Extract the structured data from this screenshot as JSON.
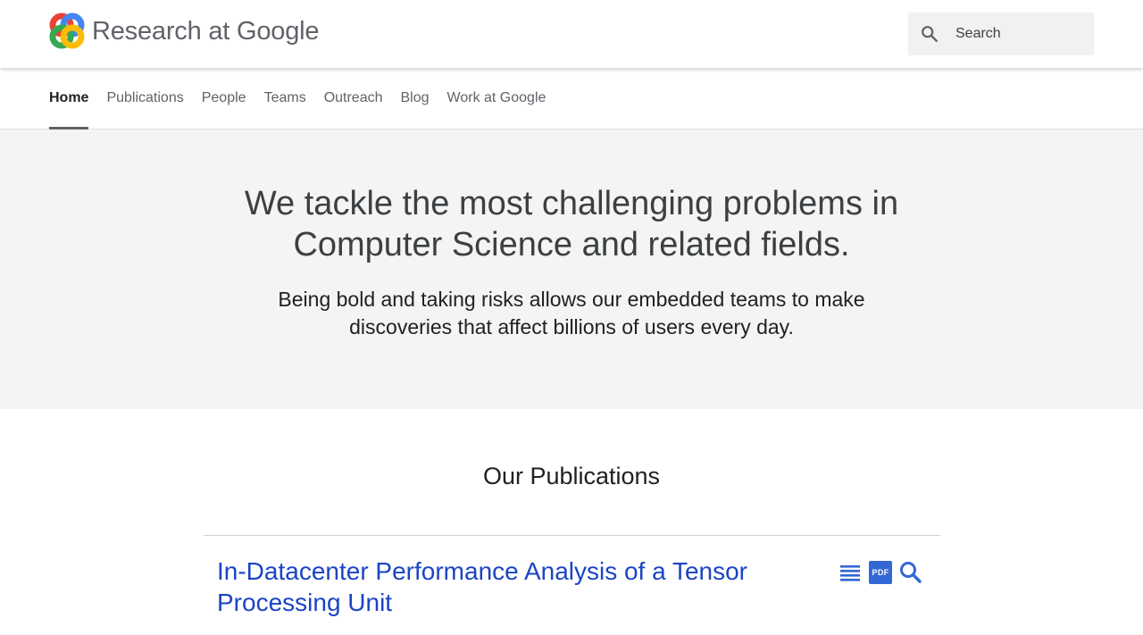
{
  "header": {
    "brand": "Research at Google",
    "search": {
      "placeholder": "Search"
    },
    "logo_colors": [
      "#ea4335",
      "#4285f4",
      "#34a853",
      "#fbbc05"
    ]
  },
  "nav": {
    "items": [
      {
        "label": "Home",
        "active": true
      },
      {
        "label": "Publications"
      },
      {
        "label": "People"
      },
      {
        "label": "Teams"
      },
      {
        "label": "Outreach"
      },
      {
        "label": "Blog"
      },
      {
        "label": "Work at Google"
      }
    ]
  },
  "hero": {
    "headline": "We tackle the most challenging problems in Computer Science and related fields.",
    "subtext": "Being bold and taking risks allows our embedded teams to make discoveries that affect billions of users every day."
  },
  "publications": {
    "heading": "Our Publications",
    "items": [
      {
        "title": "In-Datacenter Performance Analysis of a Tensor Processing Unit",
        "actions": {
          "abstract_icon": "list-icon",
          "pdf_label": "PDF",
          "search_icon": "search-icon"
        }
      }
    ]
  },
  "colors": {
    "link": "#1a44c4",
    "hero_bg": "#f4f4f4",
    "pdf_badge": "#3367d6"
  }
}
